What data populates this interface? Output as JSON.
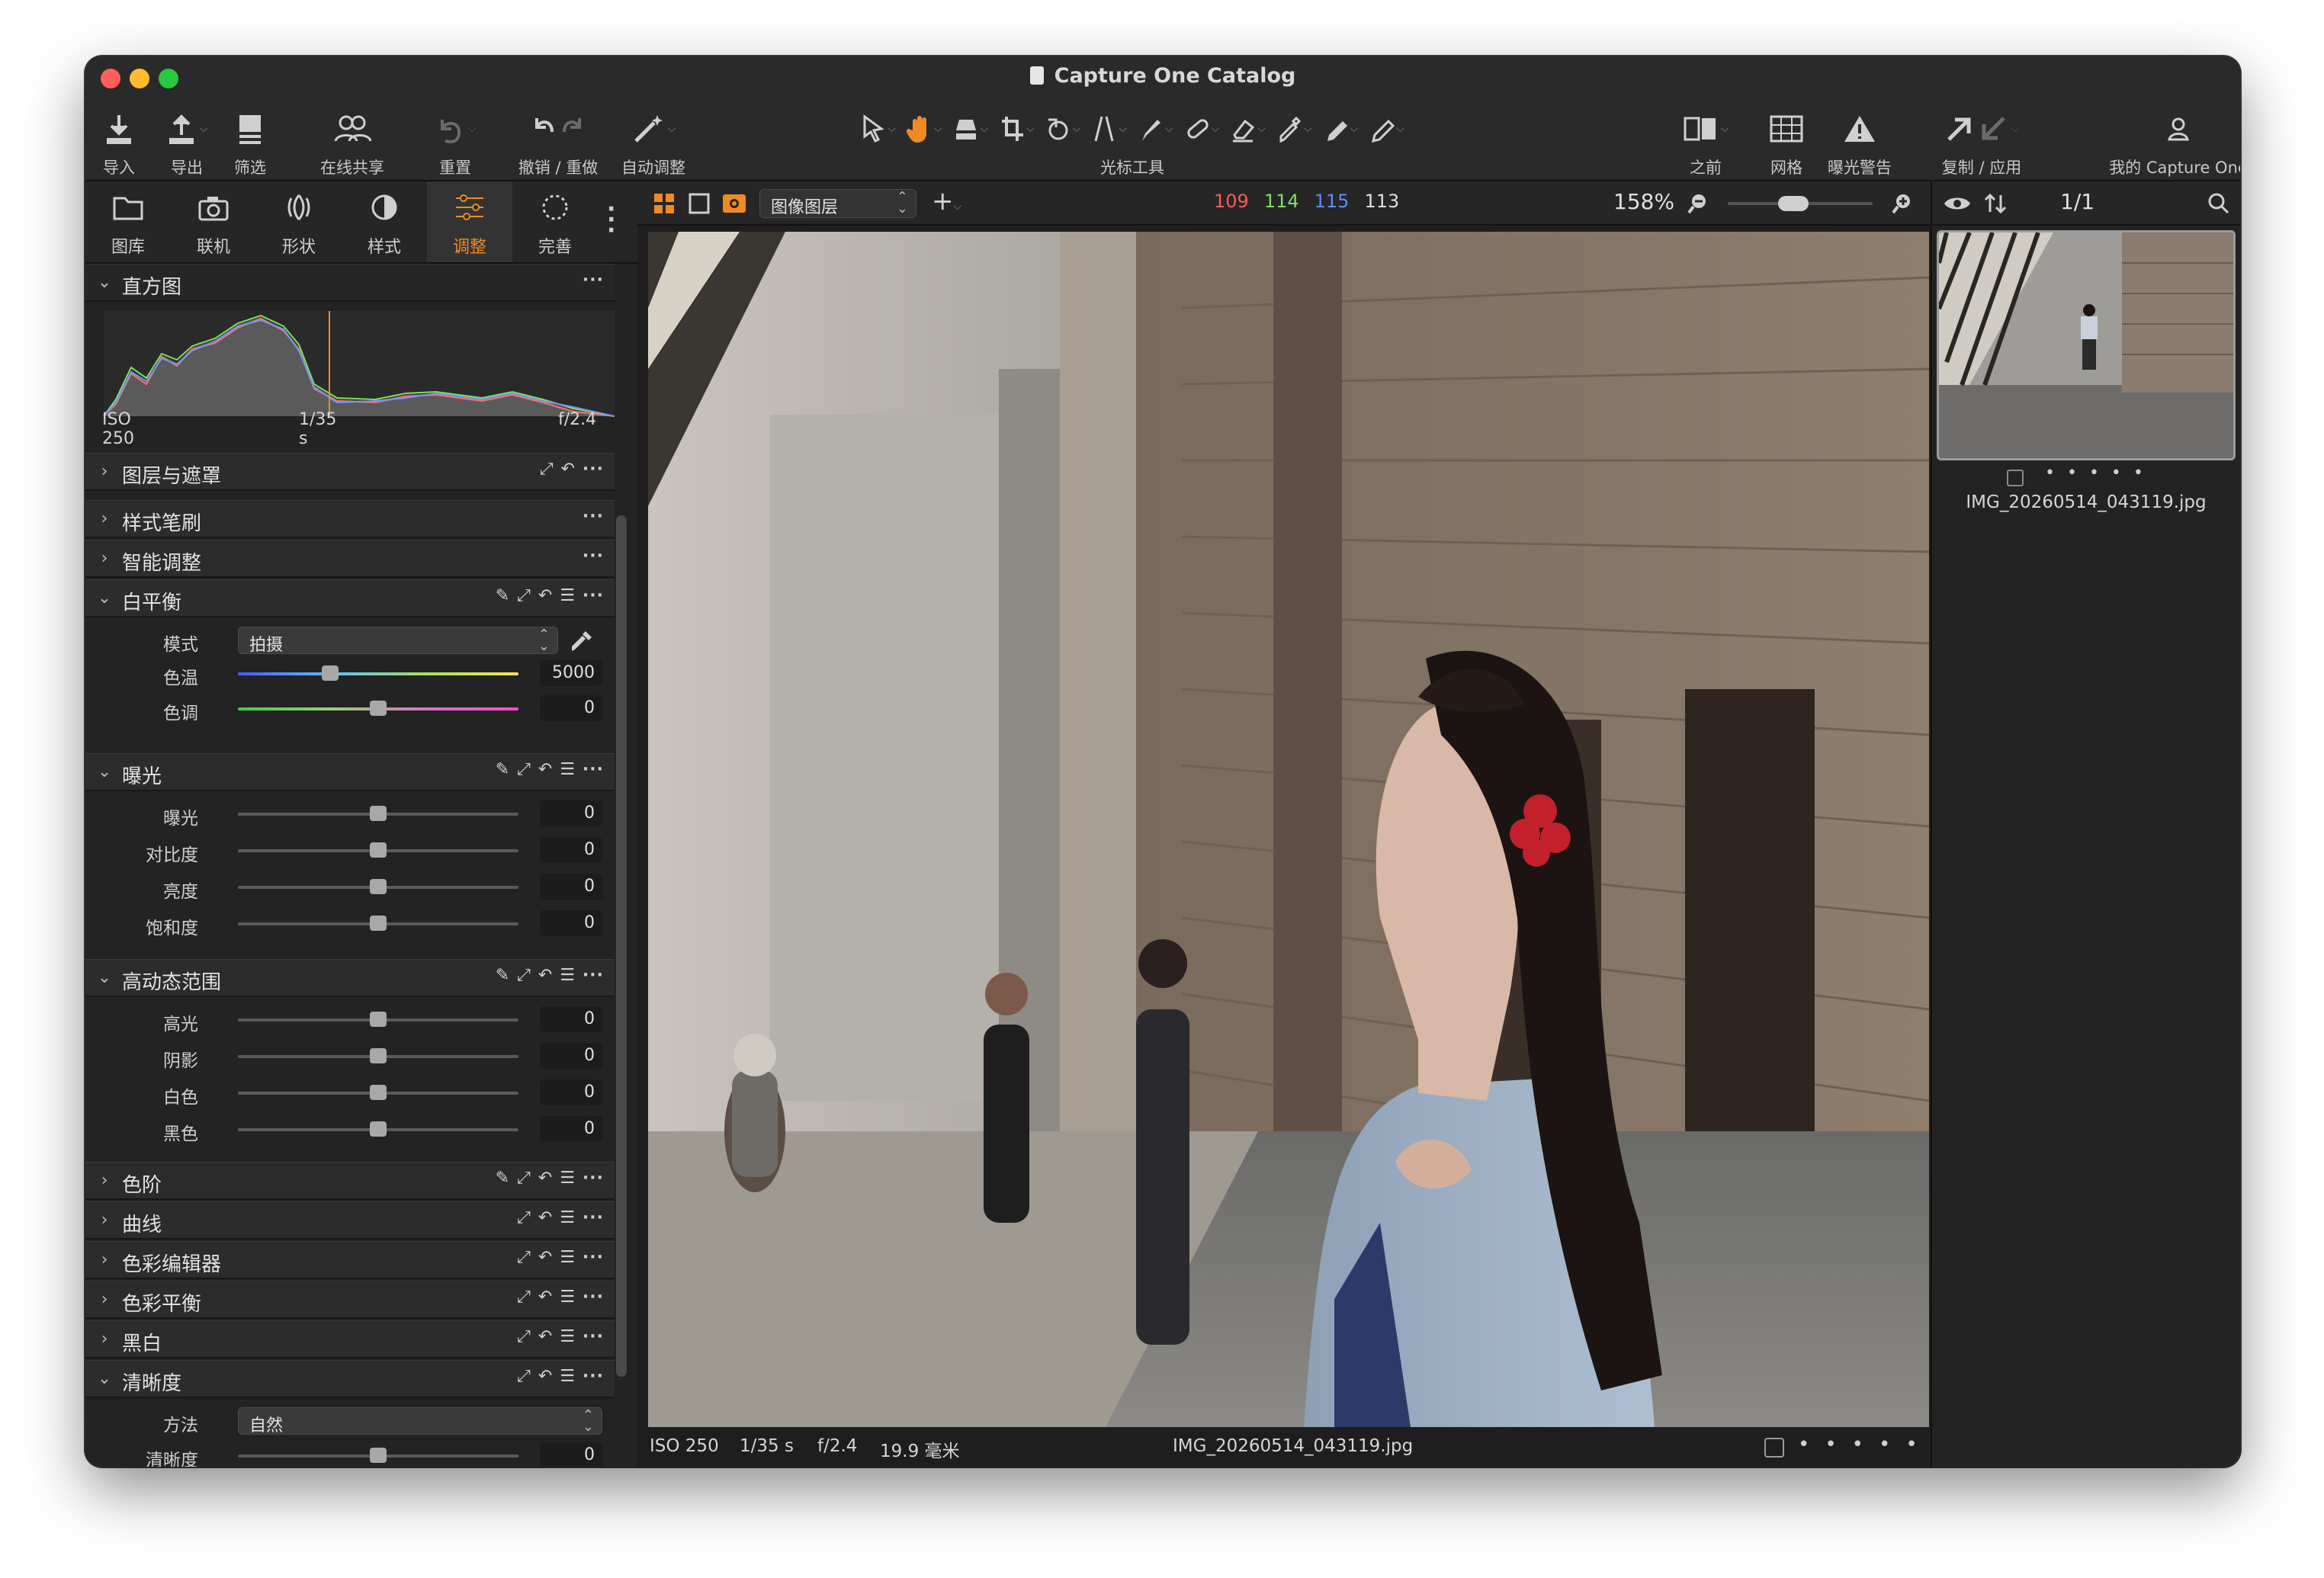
{
  "window": {
    "title": "Capture One Catalog"
  },
  "toolbar": {
    "import": "导入",
    "export": "导出",
    "filter": "筛选",
    "share": "在线共享",
    "reset": "重置",
    "undo_redo": "撤销 / 重做",
    "auto_adjust": "自动调整",
    "cursor_tools": "光标工具",
    "before": "之前",
    "grid": "网格",
    "exposure_warning": "曝光警告",
    "copy_apply": "复制 / 应用",
    "my_capture_one": "我的 Capture One"
  },
  "tool_tabs": [
    {
      "label": "图库",
      "icon": "folder-icon"
    },
    {
      "label": "联机",
      "icon": "camera-icon"
    },
    {
      "label": "形状",
      "icon": "lens-icon"
    },
    {
      "label": "样式",
      "icon": "styles-icon"
    },
    {
      "label": "调整",
      "icon": "sliders-icon",
      "active": true
    },
    {
      "label": "完善",
      "icon": "refine-icon"
    }
  ],
  "histogram": {
    "title": "直方图",
    "iso": "ISO 250",
    "shutter": "1/35 s",
    "aperture": "f/2.4"
  },
  "sections": {
    "layers": "图层与遮罩",
    "style_brushes": "样式笔刷",
    "smart_adjust": "智能调整",
    "white_balance": "白平衡",
    "exposure": "曝光",
    "hdr": "高动态范围",
    "levels": "色阶",
    "curves": "曲线",
    "color_editor": "色彩编辑器",
    "color_balance": "色彩平衡",
    "bw": "黑白",
    "clarity": "清晰度"
  },
  "white_balance": {
    "mode_label": "模式",
    "mode_value": "拍摄",
    "temp_label": "色温",
    "temp_value": "5000",
    "temp_pos": 0.33,
    "tint_label": "色调",
    "tint_value": "0",
    "tint_pos": 0.5
  },
  "exposure": [
    {
      "label": "曝光",
      "value": "0",
      "pos": 0.5
    },
    {
      "label": "对比度",
      "value": "0",
      "pos": 0.5
    },
    {
      "label": "亮度",
      "value": "0",
      "pos": 0.5
    },
    {
      "label": "饱和度",
      "value": "0",
      "pos": 0.5
    }
  ],
  "hdr": [
    {
      "label": "高光",
      "value": "0",
      "pos": 0.5
    },
    {
      "label": "阴影",
      "value": "0",
      "pos": 0.5
    },
    {
      "label": "白色",
      "value": "0",
      "pos": 0.5
    },
    {
      "label": "黑色",
      "value": "0",
      "pos": 0.5
    }
  ],
  "clarity": {
    "method_label": "方法",
    "method_value": "自然",
    "clarity_label": "清晰度",
    "clarity_value": "0",
    "clarity_pos": 0.5
  },
  "viewer": {
    "layer_select": "图像图层",
    "rgb": {
      "r": "109",
      "g": "114",
      "b": "115",
      "l": "113"
    },
    "colors": {
      "r": "#ff5a5a",
      "g": "#7ee05c",
      "b": "#5e8bff",
      "l": "#dddddd"
    },
    "zoom": "158%",
    "zoom_pos": 0.45
  },
  "status": {
    "iso": "ISO 250",
    "shutter": "1/35 s",
    "aperture": "f/2.4",
    "focal": "19.9 毫米",
    "filename": "IMG_20260514_043119.jpg"
  },
  "browser": {
    "count": "1/1",
    "filename": "IMG_20260514_043119.jpg"
  },
  "accent": "#f08a24"
}
